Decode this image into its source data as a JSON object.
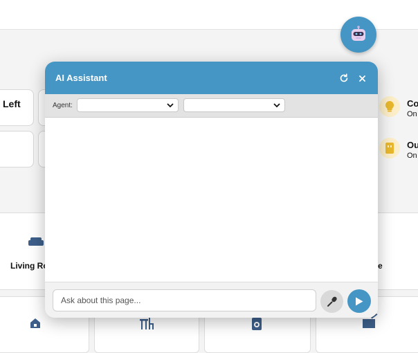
{
  "background": {
    "cards": [
      {
        "label": "Left"
      }
    ],
    "devices": [
      {
        "title": "Co",
        "status": "On",
        "icon": "lightbulb-icon"
      },
      {
        "title": "Ou",
        "status": "On",
        "icon": "outlet-icon"
      }
    ],
    "rooms": [
      {
        "label": "Living Ro",
        "icon": "sofa-icon"
      },
      {
        "label": "e",
        "icon": ""
      }
    ],
    "bottom_cards": [
      {
        "icon": "house-icon"
      },
      {
        "icon": "dining-icon"
      },
      {
        "icon": "laundry-icon"
      },
      {
        "icon": "clapper-icon"
      }
    ]
  },
  "assistant": {
    "title": "AI Assistant",
    "agent_label": "Agent:",
    "agent_select_value": "",
    "model_select_value": "",
    "input_placeholder": "Ask about this page...",
    "input_value": ""
  },
  "colors": {
    "accent": "#4596c4",
    "device_icon_bg": "#fbeec8",
    "device_icon": "#e8b72c"
  }
}
